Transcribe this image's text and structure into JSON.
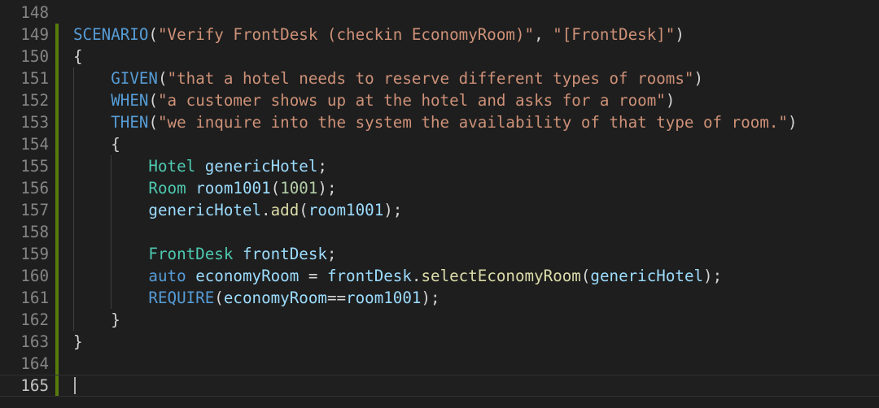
{
  "editor": {
    "theme": {
      "background": "#1e1e1e",
      "gutter_number": "#858585",
      "gutter_number_active": "#c6c6c6",
      "modified_bar": "#587c0c",
      "indent_guide": "#404040",
      "cursor": "#aeafad"
    },
    "current_line": 165,
    "lines": [
      {
        "num": "148",
        "modified": false,
        "tokens": []
      },
      {
        "num": "149",
        "modified": true,
        "tokens": [
          {
            "t": "SCENARIO",
            "c": "func"
          },
          {
            "t": "(",
            "c": "pl"
          },
          {
            "t": "\"Verify FrontDesk (checkin EconomyRoom)\"",
            "c": "str"
          },
          {
            "t": ", ",
            "c": "pl"
          },
          {
            "t": "\"[FrontDesk]\"",
            "c": "str"
          },
          {
            "t": ")",
            "c": "pl"
          }
        ]
      },
      {
        "num": "150",
        "modified": true,
        "tokens": [
          {
            "t": "{",
            "c": "pl"
          }
        ]
      },
      {
        "num": "151",
        "modified": true,
        "tokens": [
          {
            "t": "    ",
            "c": "pl"
          },
          {
            "t": "GIVEN",
            "c": "func"
          },
          {
            "t": "(",
            "c": "pl"
          },
          {
            "t": "\"that a hotel needs to reserve different types of rooms\"",
            "c": "str"
          },
          {
            "t": ")",
            "c": "pl"
          }
        ]
      },
      {
        "num": "152",
        "modified": true,
        "tokens": [
          {
            "t": "    ",
            "c": "pl"
          },
          {
            "t": "WHEN",
            "c": "func"
          },
          {
            "t": "(",
            "c": "pl"
          },
          {
            "t": "\"a customer shows up at the hotel and asks for a room\"",
            "c": "str"
          },
          {
            "t": ")",
            "c": "pl"
          }
        ]
      },
      {
        "num": "153",
        "modified": true,
        "tokens": [
          {
            "t": "    ",
            "c": "pl"
          },
          {
            "t": "THEN",
            "c": "func"
          },
          {
            "t": "(",
            "c": "pl"
          },
          {
            "t": "\"we inquire into the system the availability of that type of room.\"",
            "c": "str"
          },
          {
            "t": ")",
            "c": "pl"
          }
        ]
      },
      {
        "num": "154",
        "modified": true,
        "tokens": [
          {
            "t": "    ",
            "c": "pl"
          },
          {
            "t": "{",
            "c": "pl"
          }
        ]
      },
      {
        "num": "155",
        "modified": true,
        "tokens": [
          {
            "t": "        ",
            "c": "pl"
          },
          {
            "t": "Hotel",
            "c": "type"
          },
          {
            "t": " ",
            "c": "pl"
          },
          {
            "t": "genericHotel",
            "c": "var"
          },
          {
            "t": ";",
            "c": "pl"
          }
        ]
      },
      {
        "num": "156",
        "modified": true,
        "tokens": [
          {
            "t": "        ",
            "c": "pl"
          },
          {
            "t": "Room",
            "c": "type"
          },
          {
            "t": " ",
            "c": "pl"
          },
          {
            "t": "room1001",
            "c": "var"
          },
          {
            "t": "(",
            "c": "pl"
          },
          {
            "t": "1001",
            "c": "num"
          },
          {
            "t": ");",
            "c": "pl"
          }
        ]
      },
      {
        "num": "157",
        "modified": true,
        "tokens": [
          {
            "t": "        ",
            "c": "pl"
          },
          {
            "t": "genericHotel",
            "c": "var"
          },
          {
            "t": ".",
            "c": "pl"
          },
          {
            "t": "add",
            "c": "meth"
          },
          {
            "t": "(",
            "c": "pl"
          },
          {
            "t": "room1001",
            "c": "var"
          },
          {
            "t": ");",
            "c": "pl"
          }
        ]
      },
      {
        "num": "158",
        "modified": true,
        "tokens": []
      },
      {
        "num": "159",
        "modified": true,
        "tokens": [
          {
            "t": "        ",
            "c": "pl"
          },
          {
            "t": "FrontDesk",
            "c": "type"
          },
          {
            "t": " ",
            "c": "pl"
          },
          {
            "t": "frontDesk",
            "c": "var"
          },
          {
            "t": ";",
            "c": "pl"
          }
        ]
      },
      {
        "num": "160",
        "modified": true,
        "tokens": [
          {
            "t": "        ",
            "c": "pl"
          },
          {
            "t": "auto",
            "c": "kw"
          },
          {
            "t": " ",
            "c": "pl"
          },
          {
            "t": "economyRoom",
            "c": "var"
          },
          {
            "t": " = ",
            "c": "pl"
          },
          {
            "t": "frontDesk",
            "c": "var"
          },
          {
            "t": ".",
            "c": "pl"
          },
          {
            "t": "selectEconomyRoom",
            "c": "meth"
          },
          {
            "t": "(",
            "c": "pl"
          },
          {
            "t": "genericHotel",
            "c": "var"
          },
          {
            "t": ");",
            "c": "pl"
          }
        ]
      },
      {
        "num": "161",
        "modified": true,
        "tokens": [
          {
            "t": "        ",
            "c": "pl"
          },
          {
            "t": "REQUIRE",
            "c": "func"
          },
          {
            "t": "(",
            "c": "pl"
          },
          {
            "t": "economyRoom",
            "c": "var"
          },
          {
            "t": "==",
            "c": "pl"
          },
          {
            "t": "room1001",
            "c": "var"
          },
          {
            "t": ");",
            "c": "pl"
          }
        ]
      },
      {
        "num": "162",
        "modified": true,
        "tokens": [
          {
            "t": "    ",
            "c": "pl"
          },
          {
            "t": "}",
            "c": "pl"
          }
        ]
      },
      {
        "num": "163",
        "modified": true,
        "tokens": [
          {
            "t": "}",
            "c": "pl"
          }
        ]
      },
      {
        "num": "164",
        "modified": true,
        "tokens": []
      },
      {
        "num": "165",
        "modified": true,
        "tokens": []
      }
    ]
  }
}
